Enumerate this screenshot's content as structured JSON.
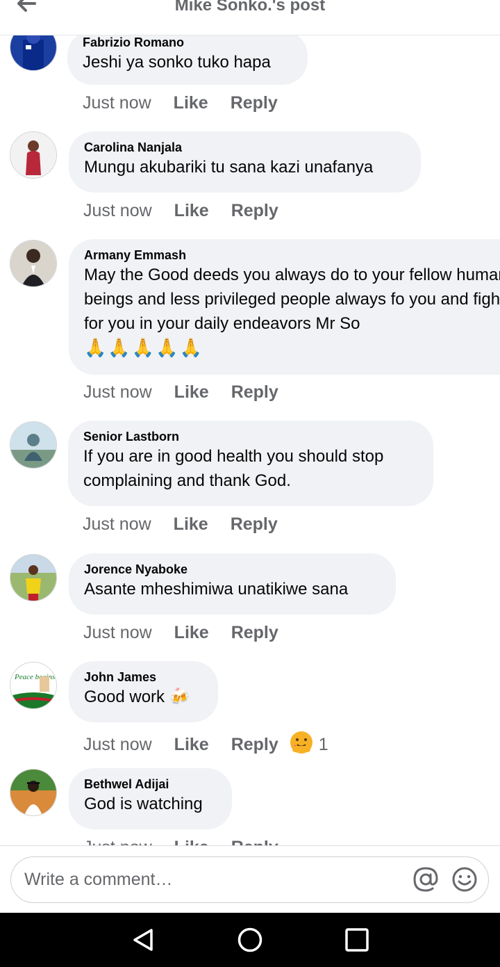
{
  "header": {
    "title": "Mike Sonko.'s post"
  },
  "actions": {
    "time": "Just now",
    "like": "Like",
    "reply": "Reply"
  },
  "comments": [
    {
      "author": "Fabrizio Romano",
      "text": "Jeshi ya sonko tuko hapa"
    },
    {
      "author": "Carolina Nanjala",
      "text": "Mungu akubariki tu sana kazi unafanya"
    },
    {
      "author": "Armany Emmash",
      "text": "May the Good deeds you always do to your fellow human beings and less privileged people always fo you and fight for you in your daily endeavors Mr So",
      "emoji": "🙏🙏🙏🙏🙏"
    },
    {
      "author": "Senior Lastborn",
      "text": "If you are in good health you should stop complaining and thank God."
    },
    {
      "author": "Jorence Nyaboke",
      "text": "Asante mheshimiwa unatikiwe sana"
    },
    {
      "author": "John James",
      "text": "Good work 🍻",
      "reaction_count": "1",
      "avatar_text": "Peace begins with me"
    },
    {
      "author": "Bethwel Adijai",
      "text": "God is watching"
    }
  ],
  "composer": {
    "placeholder": "Write a comment…"
  },
  "icons": {
    "back": "arrow-left-icon",
    "mention": "at-sign-icon",
    "emoji": "smiley-icon",
    "reaction": "care-reaction-icon",
    "nav_back": "triangle-back-icon",
    "nav_home": "circle-home-icon",
    "nav_recents": "square-recents-icon"
  },
  "colors": {
    "bubble": "#f0f2f5",
    "secondary_text": "#65676b",
    "navbar": "#000000",
    "care_reaction": "#f7b125"
  }
}
